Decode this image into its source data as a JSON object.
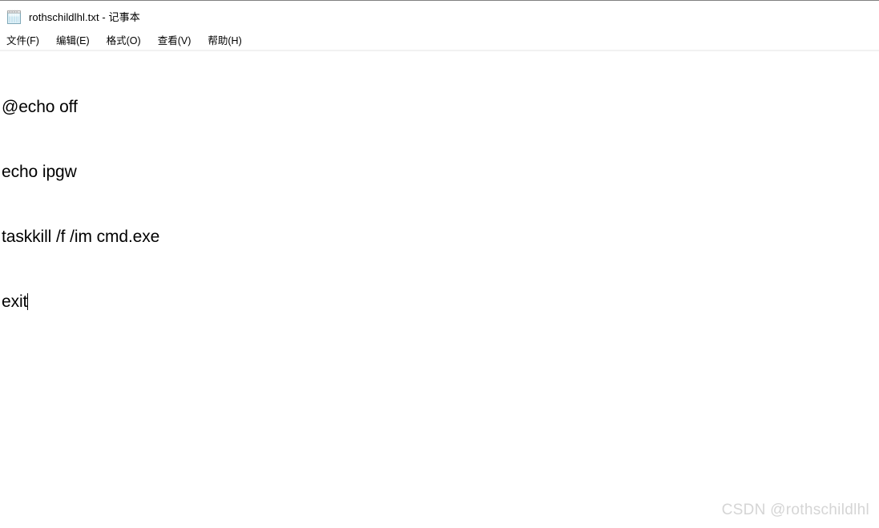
{
  "window": {
    "title": "rothschildlhl.txt - 记事本",
    "icon": "notepad-icon",
    "app": "记事本",
    "file_name": "rothschildlhl.txt"
  },
  "menu": {
    "items": [
      {
        "label": "文件(F)",
        "name": "file"
      },
      {
        "label": "编辑(E)",
        "name": "edit"
      },
      {
        "label": "格式(O)",
        "name": "format"
      },
      {
        "label": "查看(V)",
        "name": "view"
      },
      {
        "label": "帮助(H)",
        "name": "help"
      }
    ]
  },
  "editor": {
    "lines": [
      "@echo off",
      "echo ipgw",
      "taskkill /f /im cmd.exe",
      "exit"
    ],
    "caret_line": 3,
    "caret_visible": true
  },
  "watermark": {
    "text": "CSDN @rothschildlhl"
  },
  "colors": {
    "background": "#ffffff",
    "text": "#000000",
    "separator": "#f1f1f1",
    "top_border": "#808080",
    "watermark": "#d5d5d5",
    "icon_paper": "#cfe7f0",
    "icon_edge": "#8fb7c6"
  }
}
